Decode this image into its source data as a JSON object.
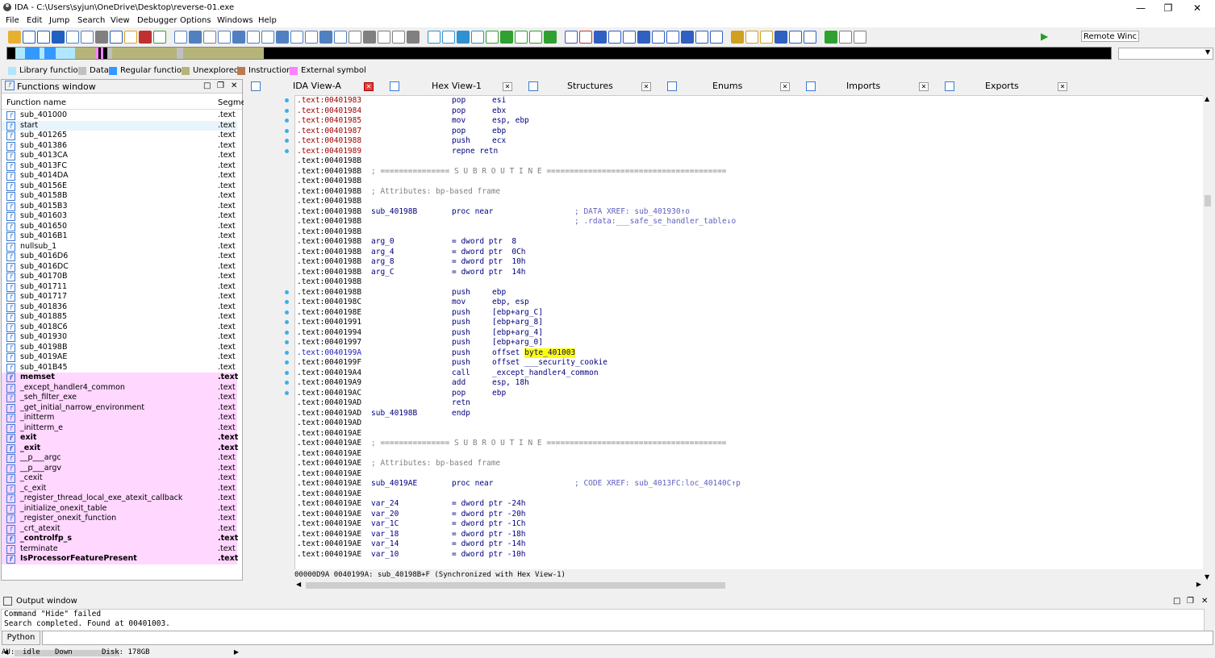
{
  "window": {
    "title": "IDA - C:\\Users\\syjun\\OneDrive\\Desktop\\reverse-01.exe"
  },
  "menu": [
    "File",
    "Edit",
    "Jump",
    "Search",
    "View",
    "Debugger",
    "Options",
    "Windows",
    "Help"
  ],
  "toolbar": {
    "debugger_select": "Remote Winc"
  },
  "legend": [
    {
      "label": "Library function",
      "color": "#aee7ff"
    },
    {
      "label": "Data",
      "color": "#c0c0c0"
    },
    {
      "label": "Regular function",
      "color": "#3399ff"
    },
    {
      "label": "Unexplored",
      "color": "#b5b57a"
    },
    {
      "label": "Instruction",
      "color": "#c07850"
    },
    {
      "label": "External symbol",
      "color": "#ff80ff"
    }
  ],
  "functions_window": {
    "title": "Functions window",
    "col_name": "Function name",
    "col_segment": "Segme",
    "items": [
      {
        "name": "sub_401000",
        "seg": ".text",
        "lib": false,
        "bold": false
      },
      {
        "name": "start",
        "seg": ".text",
        "lib": false,
        "bold": false
      },
      {
        "name": "sub_401265",
        "seg": ".text",
        "lib": false,
        "bold": false
      },
      {
        "name": "sub_401386",
        "seg": ".text",
        "lib": false,
        "bold": false
      },
      {
        "name": "sub_4013CA",
        "seg": ".text",
        "lib": false,
        "bold": false
      },
      {
        "name": "sub_4013FC",
        "seg": ".text",
        "lib": false,
        "bold": false
      },
      {
        "name": "sub_4014DA",
        "seg": ".text",
        "lib": false,
        "bold": false
      },
      {
        "name": "sub_40156E",
        "seg": ".text",
        "lib": false,
        "bold": false
      },
      {
        "name": "sub_40158B",
        "seg": ".text",
        "lib": false,
        "bold": false
      },
      {
        "name": "sub_4015B3",
        "seg": ".text",
        "lib": false,
        "bold": false
      },
      {
        "name": "sub_401603",
        "seg": ".text",
        "lib": false,
        "bold": false
      },
      {
        "name": "sub_401650",
        "seg": ".text",
        "lib": false,
        "bold": false
      },
      {
        "name": "sub_4016B1",
        "seg": ".text",
        "lib": false,
        "bold": false
      },
      {
        "name": "nullsub_1",
        "seg": ".text",
        "lib": false,
        "bold": false
      },
      {
        "name": "sub_4016D6",
        "seg": ".text",
        "lib": false,
        "bold": false
      },
      {
        "name": "sub_4016DC",
        "seg": ".text",
        "lib": false,
        "bold": false
      },
      {
        "name": "sub_40170B",
        "seg": ".text",
        "lib": false,
        "bold": false
      },
      {
        "name": "sub_401711",
        "seg": ".text",
        "lib": false,
        "bold": false
      },
      {
        "name": "sub_401717",
        "seg": ".text",
        "lib": false,
        "bold": false
      },
      {
        "name": "sub_401836",
        "seg": ".text",
        "lib": false,
        "bold": false
      },
      {
        "name": "sub_401885",
        "seg": ".text",
        "lib": false,
        "bold": false
      },
      {
        "name": "sub_4018C6",
        "seg": ".text",
        "lib": false,
        "bold": false
      },
      {
        "name": "sub_401930",
        "seg": ".text",
        "lib": false,
        "bold": false
      },
      {
        "name": "sub_40198B",
        "seg": ".text",
        "lib": false,
        "bold": false
      },
      {
        "name": "sub_4019AE",
        "seg": ".text",
        "lib": false,
        "bold": false
      },
      {
        "name": "sub_401B45",
        "seg": ".text",
        "lib": false,
        "bold": false
      },
      {
        "name": "memset",
        "seg": ".text",
        "lib": true,
        "bold": true
      },
      {
        "name": "_except_handler4_common",
        "seg": ".text",
        "lib": true,
        "bold": false
      },
      {
        "name": "_seh_filter_exe",
        "seg": ".text",
        "lib": true,
        "bold": false
      },
      {
        "name": "_get_initial_narrow_environment",
        "seg": ".text",
        "lib": true,
        "bold": false
      },
      {
        "name": "_initterm",
        "seg": ".text",
        "lib": true,
        "bold": false
      },
      {
        "name": "_initterm_e",
        "seg": ".text",
        "lib": true,
        "bold": false
      },
      {
        "name": "exit",
        "seg": ".text",
        "lib": true,
        "bold": true
      },
      {
        "name": "_exit",
        "seg": ".text",
        "lib": true,
        "bold": true
      },
      {
        "name": "__p___argc",
        "seg": ".text",
        "lib": true,
        "bold": false
      },
      {
        "name": "__p___argv",
        "seg": ".text",
        "lib": true,
        "bold": false
      },
      {
        "name": "_cexit",
        "seg": ".text",
        "lib": true,
        "bold": false
      },
      {
        "name": "_c_exit",
        "seg": ".text",
        "lib": true,
        "bold": false
      },
      {
        "name": "_register_thread_local_exe_atexit_callback",
        "seg": ".text",
        "lib": true,
        "bold": false
      },
      {
        "name": "_initialize_onexit_table",
        "seg": ".text",
        "lib": true,
        "bold": false
      },
      {
        "name": "_register_onexit_function",
        "seg": ".text",
        "lib": true,
        "bold": false
      },
      {
        "name": "_crt_atexit",
        "seg": ".text",
        "lib": true,
        "bold": false
      },
      {
        "name": "_controlfp_s",
        "seg": ".text",
        "lib": true,
        "bold": true
      },
      {
        "name": "terminate",
        "seg": ".text",
        "lib": true,
        "bold": false
      },
      {
        "name": "IsProcessorFeaturePresent",
        "seg": ".text",
        "lib": true,
        "bold": true
      }
    ]
  },
  "tabs": [
    {
      "label": "IDA View-A",
      "active": true
    },
    {
      "label": "Hex View-1",
      "active": false
    },
    {
      "label": "Structures",
      "active": false
    },
    {
      "label": "Enums",
      "active": false
    },
    {
      "label": "Imports",
      "active": false
    },
    {
      "label": "Exports",
      "active": false
    }
  ],
  "disasm": [
    {
      "addr": ".text:00401983",
      "c": "red",
      "dot": true,
      "lbl": "",
      "mn": "pop",
      "op": "esi",
      "cmt": ""
    },
    {
      "addr": ".text:00401984",
      "c": "red",
      "dot": true,
      "lbl": "",
      "mn": "pop",
      "op": "ebx",
      "cmt": ""
    },
    {
      "addr": ".text:00401985",
      "c": "red",
      "dot": true,
      "lbl": "",
      "mn": "mov",
      "op": "esp, ebp",
      "cmt": ""
    },
    {
      "addr": ".text:00401987",
      "c": "red",
      "dot": true,
      "lbl": "",
      "mn": "pop",
      "op": "ebp",
      "cmt": ""
    },
    {
      "addr": ".text:00401988",
      "c": "red",
      "dot": true,
      "lbl": "",
      "mn": "push",
      "op": "ecx",
      "cmt": ""
    },
    {
      "addr": ".text:00401989",
      "c": "red",
      "dot": true,
      "lbl": "",
      "mn": "repne retn",
      "op": "",
      "cmt": ""
    },
    {
      "addr": ".text:0040198B",
      "c": "",
      "dot": false,
      "lbl": "",
      "mn": "",
      "op": "",
      "cmt": ""
    },
    {
      "addr": ".text:0040198B",
      "c": "",
      "dot": false,
      "lbl": "; =============== S U B R O U T I N E =======================================",
      "mn": "",
      "op": "",
      "cmt": "",
      "full": true
    },
    {
      "addr": ".text:0040198B",
      "c": "",
      "dot": false,
      "lbl": "",
      "mn": "",
      "op": "",
      "cmt": ""
    },
    {
      "addr": ".text:0040198B",
      "c": "",
      "dot": false,
      "lbl": "; Attributes: bp-based frame",
      "mn": "",
      "op": "",
      "cmt": "",
      "full": true
    },
    {
      "addr": ".text:0040198B",
      "c": "",
      "dot": false,
      "lbl": "",
      "mn": "",
      "op": "",
      "cmt": ""
    },
    {
      "addr": ".text:0040198B",
      "c": "",
      "dot": false,
      "lbl": "sub_40198B",
      "mn": "proc near",
      "op": "",
      "cmt": "; DATA XREF: sub_401930↑o"
    },
    {
      "addr": ".text:0040198B",
      "c": "",
      "dot": false,
      "lbl": "",
      "mn": "",
      "op": "",
      "cmt": "; .rdata:___safe_se_handler_table↓o"
    },
    {
      "addr": ".text:0040198B",
      "c": "",
      "dot": false,
      "lbl": "",
      "mn": "",
      "op": "",
      "cmt": ""
    },
    {
      "addr": ".text:0040198B",
      "c": "",
      "dot": false,
      "lbl": "arg_0",
      "mn": "= dword ptr  8",
      "op": "",
      "cmt": "",
      "eq": true
    },
    {
      "addr": ".text:0040198B",
      "c": "",
      "dot": false,
      "lbl": "arg_4",
      "mn": "= dword ptr  0Ch",
      "op": "",
      "cmt": "",
      "eq": true
    },
    {
      "addr": ".text:0040198B",
      "c": "",
      "dot": false,
      "lbl": "arg_8",
      "mn": "= dword ptr  10h",
      "op": "",
      "cmt": "",
      "eq": true
    },
    {
      "addr": ".text:0040198B",
      "c": "",
      "dot": false,
      "lbl": "arg_C",
      "mn": "= dword ptr  14h",
      "op": "",
      "cmt": "",
      "eq": true
    },
    {
      "addr": ".text:0040198B",
      "c": "",
      "dot": false,
      "lbl": "",
      "mn": "",
      "op": "",
      "cmt": ""
    },
    {
      "addr": ".text:0040198B",
      "c": "",
      "dot": true,
      "lbl": "",
      "mn": "push",
      "op": "ebp",
      "cmt": ""
    },
    {
      "addr": ".text:0040198C",
      "c": "",
      "dot": true,
      "lbl": "",
      "mn": "mov",
      "op": "ebp, esp",
      "cmt": ""
    },
    {
      "addr": ".text:0040198E",
      "c": "",
      "dot": true,
      "lbl": "",
      "mn": "push",
      "op": "[ebp+arg_C]",
      "cmt": ""
    },
    {
      "addr": ".text:00401991",
      "c": "",
      "dot": true,
      "lbl": "",
      "mn": "push",
      "op": "[ebp+arg_8]",
      "cmt": ""
    },
    {
      "addr": ".text:00401994",
      "c": "",
      "dot": true,
      "lbl": "",
      "mn": "push",
      "op": "[ebp+arg_4]",
      "cmt": ""
    },
    {
      "addr": ".text:00401997",
      "c": "",
      "dot": true,
      "lbl": "",
      "mn": "push",
      "op": "[ebp+arg_0]",
      "cmt": ""
    },
    {
      "addr": ".text:0040199A",
      "c": "blue",
      "dot": true,
      "lbl": "",
      "mn": "push",
      "op": "offset ",
      "hlop": "byte_401003",
      "cmt": ""
    },
    {
      "addr": ".text:0040199F",
      "c": "",
      "dot": true,
      "lbl": "",
      "mn": "push",
      "op": "offset ___security_cookie",
      "cmt": ""
    },
    {
      "addr": ".text:004019A4",
      "c": "",
      "dot": true,
      "lbl": "",
      "mn": "call",
      "op": "_except_handler4_common",
      "cmt": ""
    },
    {
      "addr": ".text:004019A9",
      "c": "",
      "dot": true,
      "lbl": "",
      "mn": "add",
      "op": "esp, 18h",
      "cmt": ""
    },
    {
      "addr": ".text:004019AC",
      "c": "",
      "dot": true,
      "lbl": "",
      "mn": "pop",
      "op": "ebp",
      "cmt": ""
    },
    {
      "addr": ".text:004019AD",
      "c": "",
      "dot": false,
      "lbl": "",
      "mn": "retn",
      "op": "",
      "cmt": ""
    },
    {
      "addr": ".text:004019AD",
      "c": "",
      "dot": false,
      "lbl": "sub_40198B",
      "mn": "endp",
      "op": "",
      "cmt": ""
    },
    {
      "addr": ".text:004019AD",
      "c": "",
      "dot": false,
      "lbl": "",
      "mn": "",
      "op": "",
      "cmt": ""
    },
    {
      "addr": ".text:004019AE",
      "c": "",
      "dot": false,
      "lbl": "",
      "mn": "",
      "op": "",
      "cmt": ""
    },
    {
      "addr": ".text:004019AE",
      "c": "",
      "dot": false,
      "lbl": "; =============== S U B R O U T I N E =======================================",
      "mn": "",
      "op": "",
      "cmt": "",
      "full": true
    },
    {
      "addr": ".text:004019AE",
      "c": "",
      "dot": false,
      "lbl": "",
      "mn": "",
      "op": "",
      "cmt": ""
    },
    {
      "addr": ".text:004019AE",
      "c": "",
      "dot": false,
      "lbl": "; Attributes: bp-based frame",
      "mn": "",
      "op": "",
      "cmt": "",
      "full": true
    },
    {
      "addr": ".text:004019AE",
      "c": "",
      "dot": false,
      "lbl": "",
      "mn": "",
      "op": "",
      "cmt": ""
    },
    {
      "addr": ".text:004019AE",
      "c": "",
      "dot": false,
      "lbl": "sub_4019AE",
      "mn": "proc near",
      "op": "",
      "cmt": "; CODE XREF: sub_4013FC:loc_40140C↑p"
    },
    {
      "addr": ".text:004019AE",
      "c": "",
      "dot": false,
      "lbl": "",
      "mn": "",
      "op": "",
      "cmt": ""
    },
    {
      "addr": ".text:004019AE",
      "c": "",
      "dot": false,
      "lbl": "var_24",
      "mn": "= dword ptr -24h",
      "op": "",
      "cmt": "",
      "eq": true
    },
    {
      "addr": ".text:004019AE",
      "c": "",
      "dot": false,
      "lbl": "var_20",
      "mn": "= dword ptr -20h",
      "op": "",
      "cmt": "",
      "eq": true
    },
    {
      "addr": ".text:004019AE",
      "c": "",
      "dot": false,
      "lbl": "var_1C",
      "mn": "= dword ptr -1Ch",
      "op": "",
      "cmt": "",
      "eq": true
    },
    {
      "addr": ".text:004019AE",
      "c": "",
      "dot": false,
      "lbl": "var_18",
      "mn": "= dword ptr -18h",
      "op": "",
      "cmt": "",
      "eq": true
    },
    {
      "addr": ".text:004019AE",
      "c": "",
      "dot": false,
      "lbl": "var_14",
      "mn": "= dword ptr -14h",
      "op": "",
      "cmt": "",
      "eq": true
    },
    {
      "addr": ".text:004019AE",
      "c": "",
      "dot": false,
      "lbl": "var_10",
      "mn": "= dword ptr -10h",
      "op": "",
      "cmt": "",
      "eq": true
    }
  ],
  "disasm_status": "00000D9A 0040199A: sub_40198B+F (Synchronized with Hex View-1)",
  "output": {
    "title": "Output window",
    "lines": [
      "Command \"Hide\" failed",
      "Search completed. Found at 00401003."
    ],
    "python_label": "Python"
  },
  "statusbar": {
    "au": "AU:",
    "state": "idle",
    "dir": "Down",
    "disk": "Disk: 178GB"
  }
}
